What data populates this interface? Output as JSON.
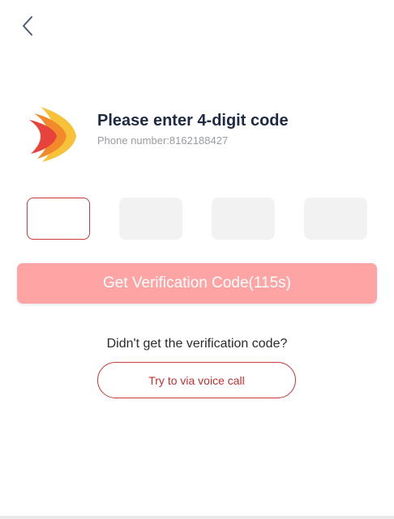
{
  "header": {
    "back_icon": "chevron-left-icon"
  },
  "brand": {
    "logo_icon": "brand-logo-icon",
    "colors": {
      "red": "#e8423d",
      "orange": "#f28a2b",
      "yellow": "#f7c23a"
    }
  },
  "verify": {
    "title": "Please enter 4-digit code",
    "phone_label": "Phone number:8162188427",
    "code_boxes": [
      "",
      "",
      "",
      ""
    ],
    "get_code_label": "Get Verification Code(115s)",
    "help_text": "Didn't get the verification code?",
    "voice_call_label": "Try to via voice call"
  },
  "colors": {
    "accent": "#cc3b3b",
    "disabled_button": "#ffa4a4",
    "title_text": "#1f2a44",
    "muted_text": "#9a9ca3"
  }
}
